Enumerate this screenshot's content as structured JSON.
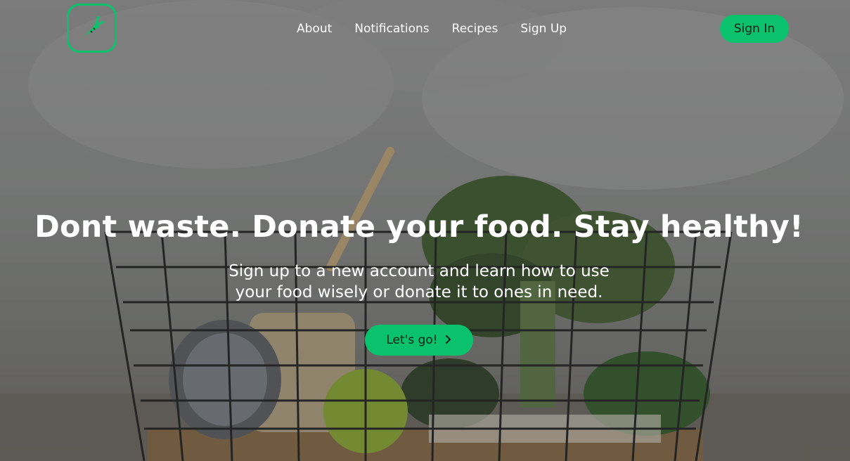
{
  "navbar": {
    "logo_icon": "carrot-icon",
    "links": [
      {
        "label": "About"
      },
      {
        "label": "Notifications"
      },
      {
        "label": "Recipes"
      },
      {
        "label": "Sign Up"
      }
    ],
    "signin_label": "Sign In"
  },
  "hero": {
    "headline": "Dont waste. Donate your food. Stay healthy!",
    "subtext": "Sign up to a new account and learn how to use your food wisely or donate it to ones in need.",
    "cta_label": "Let's go!",
    "cta_icon": "chevron-right-icon",
    "background_image": "basket-of-vegetables-photo"
  },
  "colors": {
    "accent": "#0bc26c",
    "text_light": "#ffffff",
    "button_text": "#102018"
  }
}
